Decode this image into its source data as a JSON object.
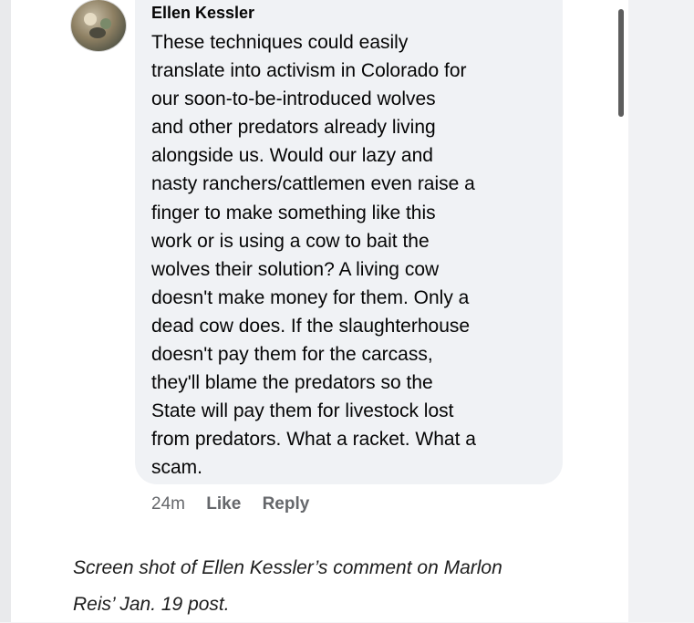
{
  "comment": {
    "author": "Ellen Kessler",
    "lines": [
      "These techniques could easily",
      "translate into activism in Colorado for",
      "our soon-to-be-introduced wolves",
      "and other predators already living",
      "alongside us. Would our lazy and",
      "nasty ranchers/cattlemen even raise a",
      "finger to make something like this",
      "work or is using a cow to bait the",
      "wolves their solution? A living cow",
      "doesn't make money for them. Only a",
      "dead cow does. If the slaughterhouse",
      "doesn't pay them for the carcass,",
      "they'll blame the predators so the",
      "State will pay them for livestock lost",
      "from predators. What a racket. What a",
      "scam."
    ],
    "timestamp": "24m",
    "like_label": "Like",
    "reply_label": "Reply"
  },
  "caption": {
    "lines": [
      "Screen shot of Ellen Kessler’s comment on Marlon",
      "Reis’ Jan. 19 post."
    ]
  },
  "colors": {
    "bubble": "#f0f2f5",
    "text": "#050505",
    "meta": "#65676b",
    "scrollbar": "#5d5d5d"
  }
}
